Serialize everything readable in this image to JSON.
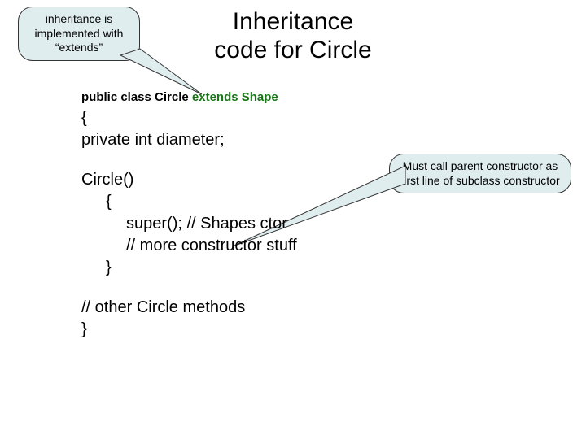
{
  "title_line1": "Inheritance",
  "title_line2": "code for Circle",
  "callout_left": "inheritance is implemented with  “extends”",
  "callout_right": "Must call parent constructor as first line of subclass constructor",
  "code": {
    "decl_pre": "public class Circle ",
    "decl_ext": "extends Shape",
    "brace_open": "{",
    "field": " private int diameter;",
    "ctor_head": "Circle()",
    "ctor_open": "{",
    "ctor_l1": "super(); // Shapes ctor",
    "ctor_l2": "// more constructor stuff",
    "ctor_close": "}",
    "other": "// other Circle methods",
    "brace_close": "}"
  }
}
